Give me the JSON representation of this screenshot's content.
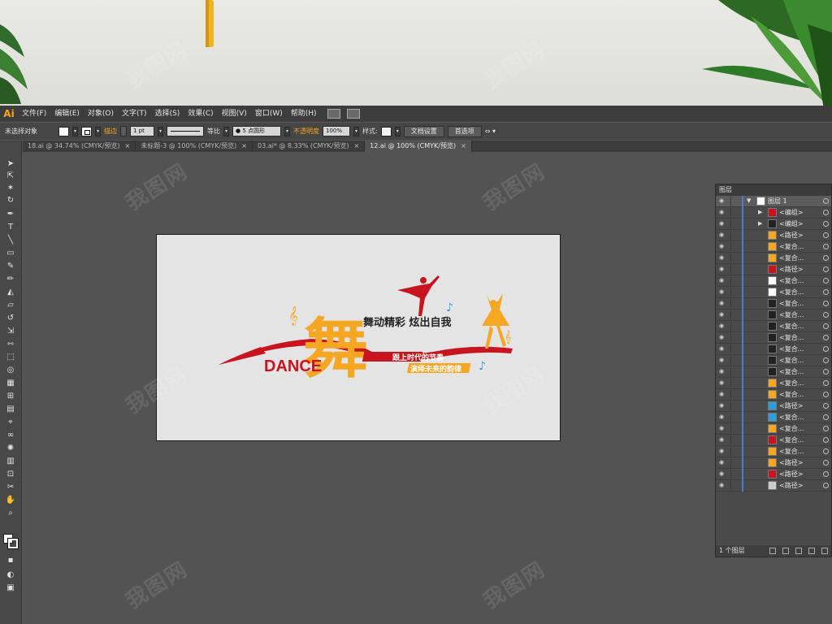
{
  "app": {
    "logo": "Ai"
  },
  "menu": [
    "文件(F)",
    "编辑(E)",
    "对象(O)",
    "文字(T)",
    "选择(S)",
    "效果(C)",
    "视图(V)",
    "窗口(W)",
    "帮助(H)"
  ],
  "control_bar": {
    "selection_status": "未选择对象",
    "stroke_label": "描边",
    "stroke_weight": "1 pt",
    "profile": "等比",
    "brush": "5 点圆形",
    "opacity_label": "不透明度",
    "opacity_value": "100%",
    "style_label": "样式:",
    "doc_setup_button": "文档设置",
    "prefs_button": "首选项"
  },
  "tabs": [
    {
      "label": "18.ai @ 34.74% (CMYK/预览)",
      "close": "×"
    },
    {
      "label": "未标题-3 @ 100% (CMYK/预览)",
      "close": "×"
    },
    {
      "label": "03.ai* @ 8.33% (CMYK/预览)",
      "close": "×"
    },
    {
      "label": "12.ai @ 100% (CMYK/预览)",
      "close": "×"
    }
  ],
  "artwork": {
    "main_character": "舞",
    "slogan": "舞动精彩  炫出自我",
    "word_dance": "DANCE",
    "banner_1": "跟上时代的节奏",
    "banner_2": "演绎未来的韵律",
    "colors": {
      "red": "#c8141e",
      "orange": "#f5a623",
      "note_blue": "#2d9fd8"
    }
  },
  "layers_panel": {
    "title": "图层",
    "top_layer": "图层 1",
    "rows": [
      "<编组>",
      "<编组>",
      "<路径>",
      "<复合...",
      "<复合...",
      "<路径>",
      "<复合...",
      "<复合...",
      "<复合...",
      "<复合...",
      "<复合...",
      "<复合...",
      "<复合...",
      "<复合...",
      "<复合...",
      "<复合...",
      "<复合...",
      "<路径>",
      "<复合...",
      "<复合...",
      "<复合...",
      "<复合...",
      "<路径>",
      "<路径>",
      "<路径>"
    ],
    "footer": "1 个图层"
  },
  "watermark": "我图网"
}
